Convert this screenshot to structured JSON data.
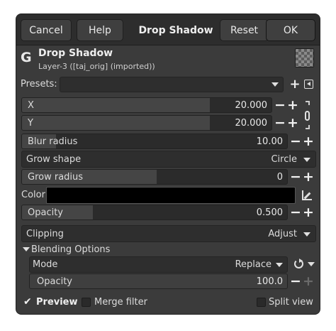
{
  "header": {
    "cancel_label": "Cancel",
    "help_label": "Help",
    "title": "Drop Shadow",
    "reset_label": "Reset",
    "ok_label": "OK"
  },
  "filter": {
    "logo_glyph": "G",
    "name": "Drop Shadow",
    "layer": "Layer-3 ([taj_orig] (imported))"
  },
  "presets": {
    "label": "Presets:",
    "value": ""
  },
  "params": {
    "x": {
      "label": "X",
      "value": "20.000",
      "fill": 0.7
    },
    "y": {
      "label": "Y",
      "value": "20.000",
      "fill": 0.7
    },
    "blur_radius": {
      "label": "Blur radius",
      "value": "10.00",
      "fill": 0.13
    },
    "grow_shape": {
      "label": "Grow shape",
      "value": "Circle"
    },
    "grow_radius": {
      "label": "Grow radius",
      "value": "0",
      "fill": 0.5
    },
    "color": {
      "label": "Color",
      "value": "#000000"
    },
    "opacity": {
      "label": "Opacity",
      "value": "0.500",
      "fill": 0.25
    },
    "clipping": {
      "label": "Clipping",
      "value": "Adjust"
    }
  },
  "blending": {
    "section_label": "Blending Options",
    "mode_label": "Mode",
    "mode_value": "Replace",
    "opacity_label": "Opacity",
    "opacity_value": "100.0"
  },
  "footer": {
    "preview_label": "Preview",
    "preview_checked": true,
    "merge_label": "Merge filter",
    "merge_checked": false,
    "split_label": "Split view",
    "split_checked": false
  },
  "glyphs": {
    "plus": "+",
    "minus": "−",
    "check": "✔"
  },
  "colors": {
    "background": "#3b3b3b",
    "header": "#2d2d2d",
    "field": "#2b2b2b",
    "accent_fill": "#454545"
  }
}
